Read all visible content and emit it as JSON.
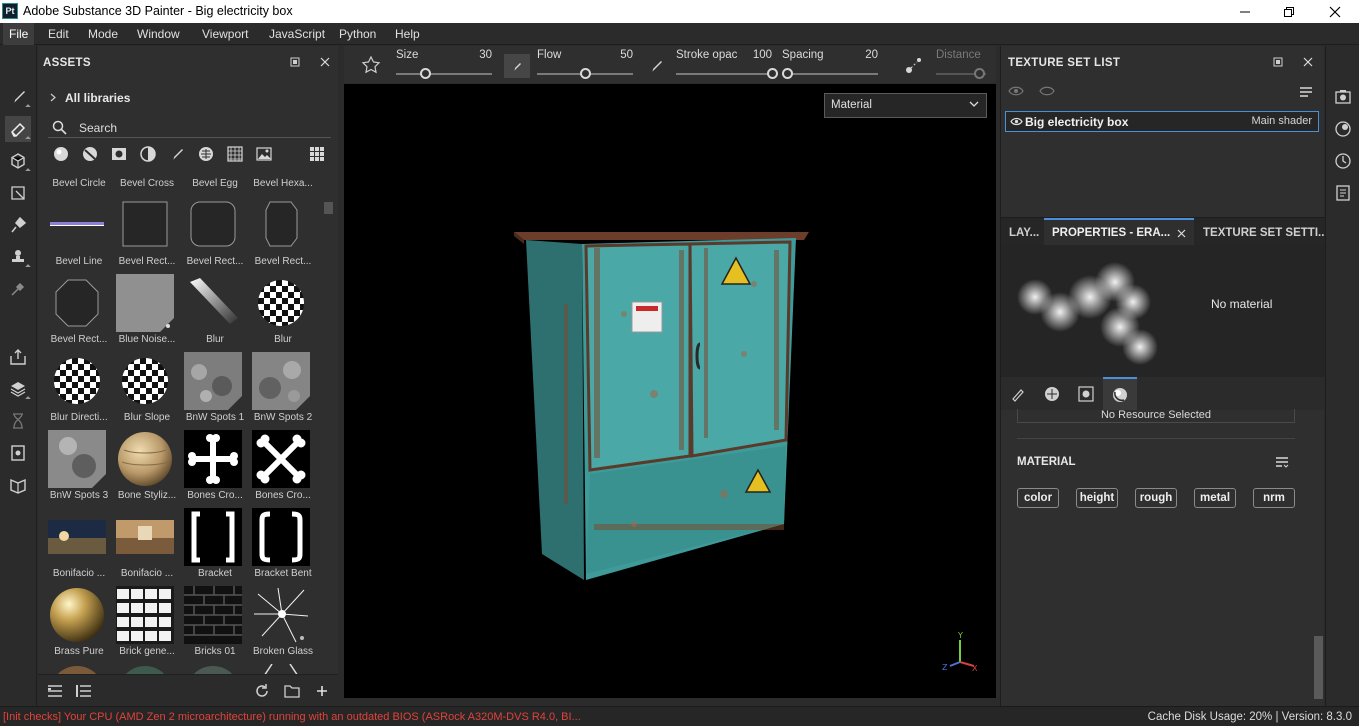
{
  "window": {
    "app_logo": "Pt",
    "title": "Adobe Substance 3D Painter - Big electricity box"
  },
  "menu": [
    "File",
    "Edit",
    "Mode",
    "Window",
    "Viewport",
    "JavaScript",
    "Python",
    "Help"
  ],
  "assets": {
    "title": "ASSETS",
    "library": "All libraries",
    "search_placeholder": "Search",
    "rows": [
      [
        "Bevel Circle",
        "Bevel Cross",
        "Bevel Egg",
        "Bevel Hexa..."
      ],
      [
        "Bevel Line",
        "Bevel Rect...",
        "Bevel Rect...",
        "Bevel Rect..."
      ],
      [
        "Bevel Rect...",
        "Blue Noise...",
        "Blur",
        "Blur"
      ],
      [
        "Blur Directi...",
        "Blur Slope",
        "BnW Spots 1",
        "BnW Spots 2"
      ],
      [
        "BnW Spots 3",
        "Bone Styliz...",
        "Bones Cro...",
        "Bones Cro..."
      ],
      [
        "Bonifacio ...",
        "Bonifacio ...",
        "Bracket",
        "Bracket Bent"
      ],
      [
        "Brass Pure",
        "Brick gene...",
        "Bricks 01",
        "Broken Glass"
      ]
    ]
  },
  "toolbar": {
    "size_label": "Size",
    "size_value": "30",
    "size_fraction": 0.3,
    "flow_label": "Flow",
    "flow_value": "50",
    "flow_fraction": 0.5,
    "stroke_label": "Stroke opac",
    "stroke_value": "100",
    "stroke_fraction": 1.0,
    "spacing_label": "Spacing",
    "spacing_value": "20",
    "spacing_fraction": 0.05,
    "distance_label": "Distance"
  },
  "viewport": {
    "mode": "Material",
    "axis_y": "Y",
    "axis_z": "Z",
    "axis_x": "X"
  },
  "texture_set": {
    "title": "TEXTURE SET LIST",
    "name": "Big electricity box",
    "shader": "Main shader"
  },
  "tabs": [
    "LAY...",
    "PROPERTIES - ERA...",
    "TEXTURE SET SETTI..."
  ],
  "properties": {
    "no_material": "No material",
    "no_resource": "No Resource Selected",
    "material_title": "MATERIAL",
    "channels": [
      "color",
      "height",
      "rough",
      "metal",
      "nrm"
    ]
  },
  "status": {
    "message": "[Init checks] Your CPU (AMD Zen 2 microarchitecture) running with an outdated BIOS (ASRock A320M-DVS R4.0, BI...",
    "right": "Cache Disk Usage:   20% | Version: 8.3.0"
  },
  "colors": {
    "accent": "#4a90d9",
    "error": "#e0433b",
    "cabinet": "#3f9a9a",
    "rust": "#6b3d2a"
  }
}
